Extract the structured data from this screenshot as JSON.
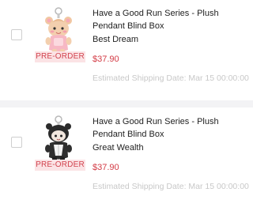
{
  "cart": {
    "items": [
      {
        "title": "Have a Good Run Series - Plush Pendant Blind Box",
        "variant": "Best Dream",
        "badge": "PRE-ORDER",
        "price": "$37.90",
        "shipping": "Estimated Shipping Date: Mar 15 00:00:00",
        "thumbnail_icon": "plush-pendant-pink-icon",
        "selected": false
      },
      {
        "title": "Have a Good Run Series - Plush Pendant Blind Box",
        "variant": "Great Wealth",
        "badge": "PRE-ORDER",
        "price": "$37.90",
        "shipping": "Estimated Shipping Date: Mar 15 00:00:00",
        "thumbnail_icon": "plush-pendant-black-icon",
        "selected": false
      }
    ]
  },
  "colors": {
    "price": "#d33a44",
    "badge_text": "#d2444f",
    "badge_bg": "#fbe3e5",
    "muted_text": "#c8c8c8"
  }
}
